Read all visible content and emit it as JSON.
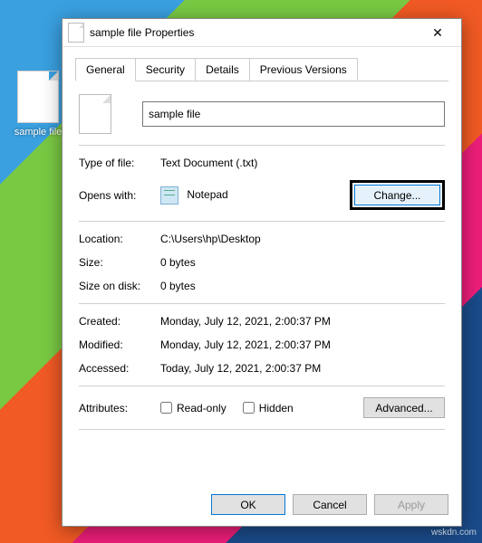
{
  "desktop": {
    "icon_label": "sample file"
  },
  "dialog": {
    "title": "sample file Properties",
    "close_glyph": "✕"
  },
  "tabs": {
    "general": "General",
    "security": "Security",
    "details": "Details",
    "previous": "Previous Versions"
  },
  "general": {
    "filename": "sample file",
    "type_label": "Type of file:",
    "type_value": "Text Document (.txt)",
    "opens_label": "Opens with:",
    "opens_app": "Notepad",
    "change_btn": "Change...",
    "location_label": "Location:",
    "location_value": "C:\\Users\\hp\\Desktop",
    "size_label": "Size:",
    "size_value": "0 bytes",
    "sod_label": "Size on disk:",
    "sod_value": "0 bytes",
    "created_label": "Created:",
    "created_value": "Monday, July 12, 2021, 2:00:37 PM",
    "modified_label": "Modified:",
    "modified_value": "Monday, July 12, 2021, 2:00:37 PM",
    "accessed_label": "Accessed:",
    "accessed_value": "Today, July 12, 2021, 2:00:37 PM",
    "attrib_label": "Attributes:",
    "readonly": "Read-only",
    "hidden": "Hidden",
    "advanced": "Advanced..."
  },
  "buttons": {
    "ok": "OK",
    "cancel": "Cancel",
    "apply": "Apply"
  },
  "watermark": "wskdn.com",
  "colors": {
    "accent": "#0078d7"
  }
}
